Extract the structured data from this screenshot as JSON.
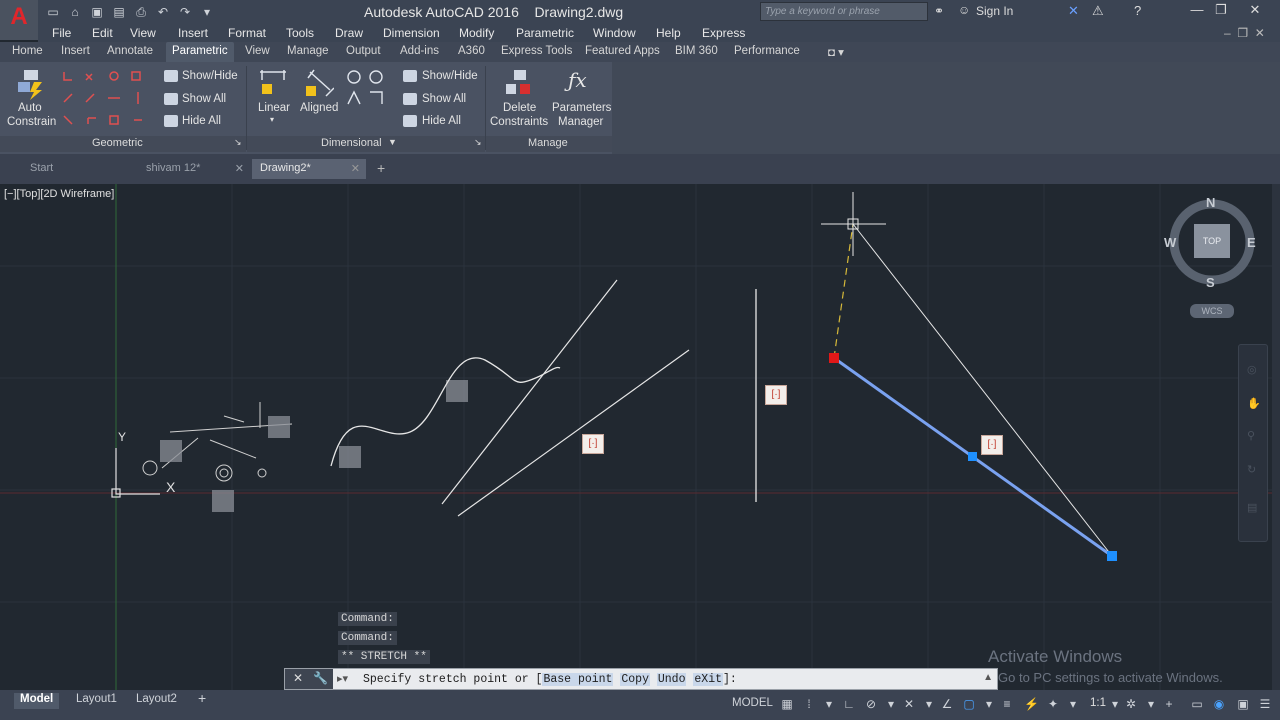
{
  "titlebar": {
    "title": "Autodesk AutoCAD 2016    Drawing2.dwg",
    "search_placeholder": "Type a keyword or phrase",
    "sign_in": "Sign In"
  },
  "menu": [
    "File",
    "Edit",
    "View",
    "Insert",
    "Format",
    "Tools",
    "Draw",
    "Dimension",
    "Modify",
    "Parametric",
    "Window",
    "Help",
    "Express"
  ],
  "ribbon_tabs": [
    "Home",
    "Insert",
    "Annotate",
    "Parametric",
    "View",
    "Manage",
    "Output",
    "Add-ins",
    "A360",
    "Express Tools",
    "Featured Apps",
    "BIM 360",
    "Performance"
  ],
  "ribbon": {
    "auto_constrain": "Auto",
    "auto_constrain_2": "Constrain",
    "geo_show_hide": "Show/Hide",
    "geo_show_all": "Show All",
    "geo_hide_all": "Hide All",
    "linear": "Linear",
    "aligned": "Aligned",
    "dim_show_hide": "Show/Hide",
    "dim_show_all": "Show All",
    "dim_hide_all": "Hide All",
    "delete_1": "Delete",
    "delete_2": "Constraints",
    "params_1": "Parameters",
    "params_2": "Manager",
    "panel_geometric": "Geometric",
    "panel_dimensional": "Dimensional",
    "panel_manage": "Manage"
  },
  "doc_tabs": [
    "Start",
    "shivam 12*",
    "Drawing2*"
  ],
  "viewport_label": "[−][Top][2D Wireframe]",
  "viewcube": {
    "n": "N",
    "s": "S",
    "e": "E",
    "w": "W",
    "top": "TOP",
    "wcs": "WCS"
  },
  "ucs": {
    "y": "Y",
    "x": "X"
  },
  "command_history": [
    "Command:",
    "Command:",
    "** STRETCH **"
  ],
  "command_line": {
    "prefix": "Specify stretch point or [",
    "opt1": "Base point",
    "opt2": "Copy",
    "opt3": "Undo",
    "opt4": "eXit",
    "suffix": "]:"
  },
  "watermark": {
    "title": "Activate Windows",
    "sub": "Go to PC settings to activate Windows."
  },
  "layout_tabs": [
    "Model",
    "Layout1",
    "Layout2"
  ],
  "status": {
    "model": "MODEL",
    "scale": "1:1"
  },
  "colors": {
    "accent_grip": "#1e90ff",
    "hot_grip": "#e01818",
    "selected_line": "#7aa2f0"
  }
}
